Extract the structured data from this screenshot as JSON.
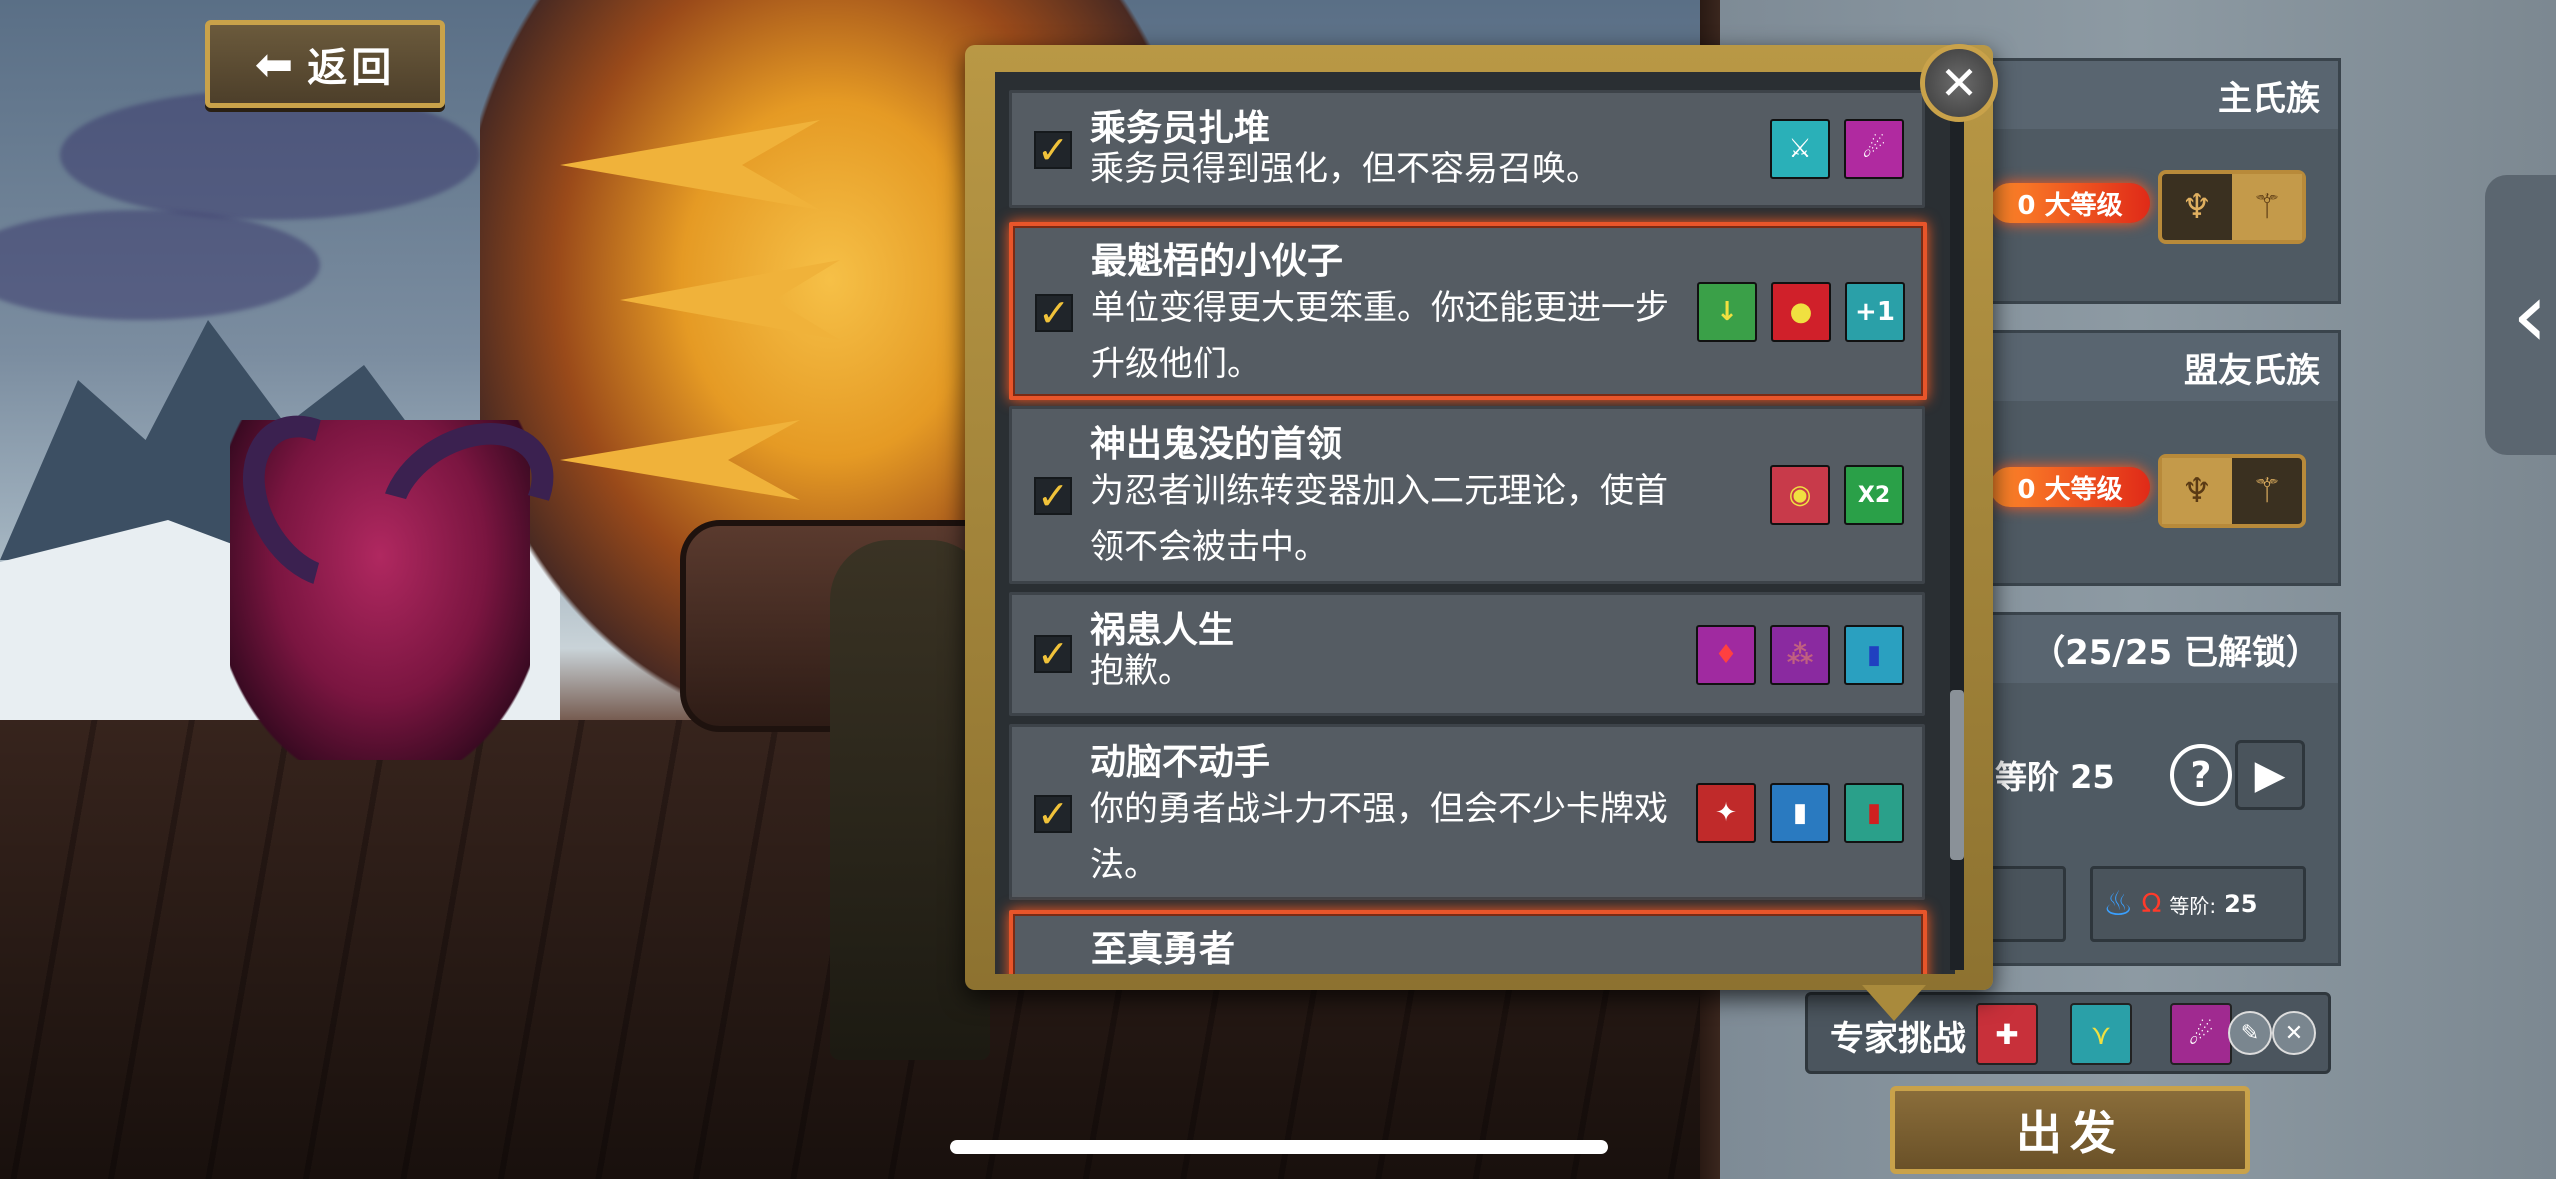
{
  "header": {
    "back_label": "返回"
  },
  "popup": {
    "cards": [
      {
        "title": "乘务员扎堆",
        "desc": "乘务员得到强化，但不容易召唤。",
        "checked": true,
        "selected": false,
        "icons": [
          "crew-icon",
          "summon-portal-icon"
        ]
      },
      {
        "title": "最魁梧的小伙子",
        "desc": "单位变得更大更笨重。你还能更进一步升级他们。",
        "checked": true,
        "selected": true,
        "icons": [
          "heavy-unit-icon",
          "upgrade-plus-icon",
          "plus-one-icon"
        ],
        "icon3_text": "+1"
      },
      {
        "title": "神出鬼没的首领",
        "desc": "为忍者训练转变器加入二元理论，使首领不会被击中。",
        "checked": true,
        "selected": false,
        "icons": [
          "angry-eyes-icon",
          "x2-icon"
        ],
        "icon2_text": "X2"
      },
      {
        "title": "祸患人生",
        "desc": "抱歉。",
        "checked": true,
        "selected": false,
        "icons": [
          "blood-drops-icon",
          "spores-icon",
          "card-deck-icon"
        ]
      },
      {
        "title": "动脑不动手",
        "desc": "你的勇者战斗力不强，但会不少卡牌戏法。",
        "checked": true,
        "selected": false,
        "icons": [
          "weak-hero-icon",
          "blue-cards-icon",
          "red-card-icon"
        ]
      },
      {
        "title": "至真勇者",
        "desc": "",
        "checked": true,
        "selected": true,
        "icons": []
      }
    ]
  },
  "side": {
    "main_clan": "主氏族",
    "ally_clan": "盟友氏族",
    "level_label_main": "0 大等级",
    "level_label_ally": "0 大等级",
    "unlock_status": "（25/25 已解锁）",
    "tier_label": "等阶 25",
    "help": "?",
    "stat_prefix": "等阶:",
    "stat_value": "25",
    "challenge_label": "专家挑战",
    "go_label": "出发"
  },
  "colors": {
    "accent_gold": "#c9a24a",
    "selected_glow": "#e8552a",
    "check": "#f0c23a"
  }
}
